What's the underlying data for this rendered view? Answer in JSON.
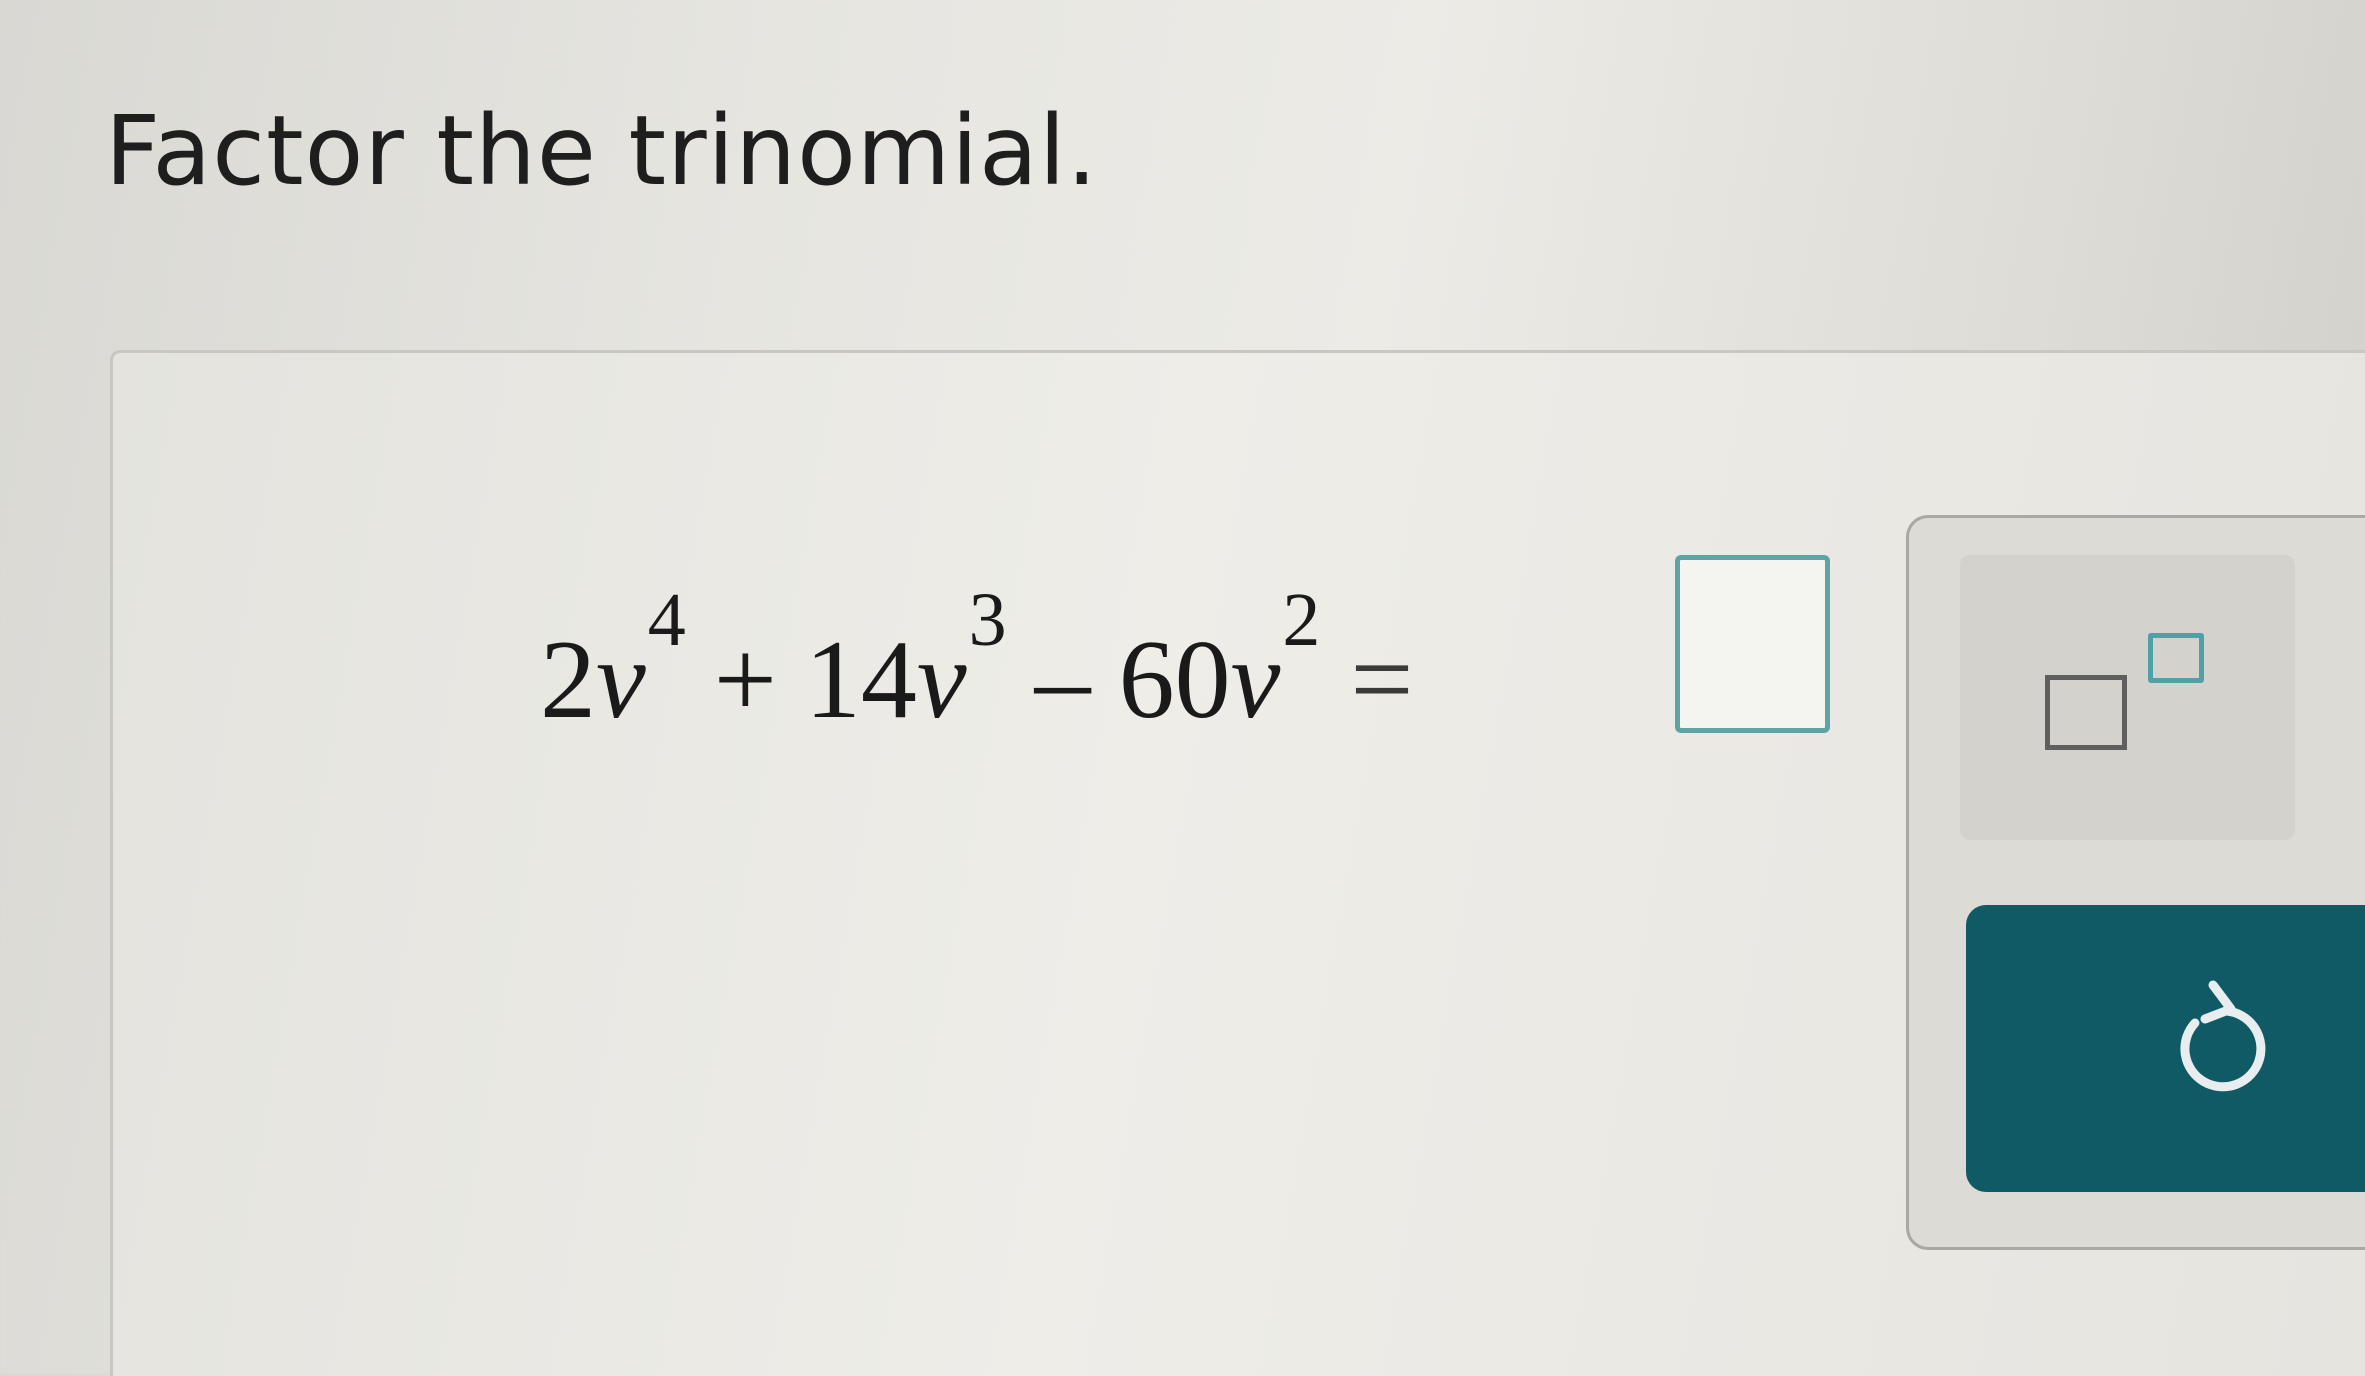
{
  "question": {
    "prompt": "Factor the trinomial."
  },
  "equation": {
    "terms": [
      {
        "coefficient": "2",
        "variable": "v",
        "exponent": "4"
      },
      {
        "operator": "+",
        "coefficient": "14",
        "variable": "v",
        "exponent": "3"
      },
      {
        "operator": "–",
        "coefficient": "60",
        "variable": "v",
        "exponent": "2"
      }
    ],
    "equals": "="
  },
  "answer": {
    "value": ""
  },
  "toolbar": {
    "exponent_icon": "exponent-template-icon",
    "undo_icon": "undo-arrow-icon"
  },
  "colors": {
    "answer_box_border": "#5fa3a5",
    "undo_button_bg": "#0f5a64",
    "exponent_sup_box": "#4fa0a7"
  }
}
